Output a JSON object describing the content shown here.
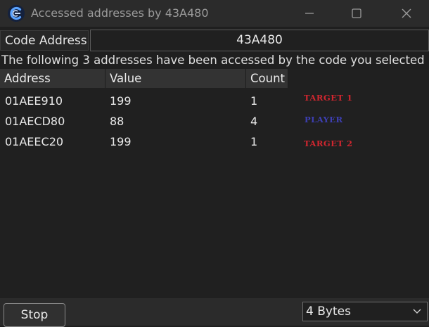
{
  "window": {
    "title": "Accessed addresses by 43A480",
    "icon": "cheat-engine-logo-icon",
    "controls": [
      "minimize-icon",
      "maximize-icon",
      "close-icon"
    ]
  },
  "code_address": {
    "label": "Code Address",
    "value": "43A480"
  },
  "description": "The following 3 addresses have been accessed by the code you selected",
  "table": {
    "columns": [
      "Address",
      "Value",
      "Count"
    ],
    "rows": [
      {
        "address": "01AEE910",
        "value": "199",
        "count": "1"
      },
      {
        "address": "01AECD80",
        "value": "88",
        "count": "4"
      },
      {
        "address": "01AEEC20",
        "value": "199",
        "count": "1"
      }
    ]
  },
  "annotations": [
    {
      "text": "TARGET 1",
      "color": "#d0262f"
    },
    {
      "text": "PLAYER",
      "color": "#3d3fb3"
    },
    {
      "text": "TARGET 2",
      "color": "#d0262f"
    }
  ],
  "footer": {
    "stop_label": "Stop",
    "size_selected": "4 Bytes"
  },
  "colors": {
    "background": "#1f1f1f",
    "titlebar": "#2b2b2b",
    "header": "#333333",
    "target_red": "#d0262f",
    "player_blue": "#3d3fb3"
  }
}
